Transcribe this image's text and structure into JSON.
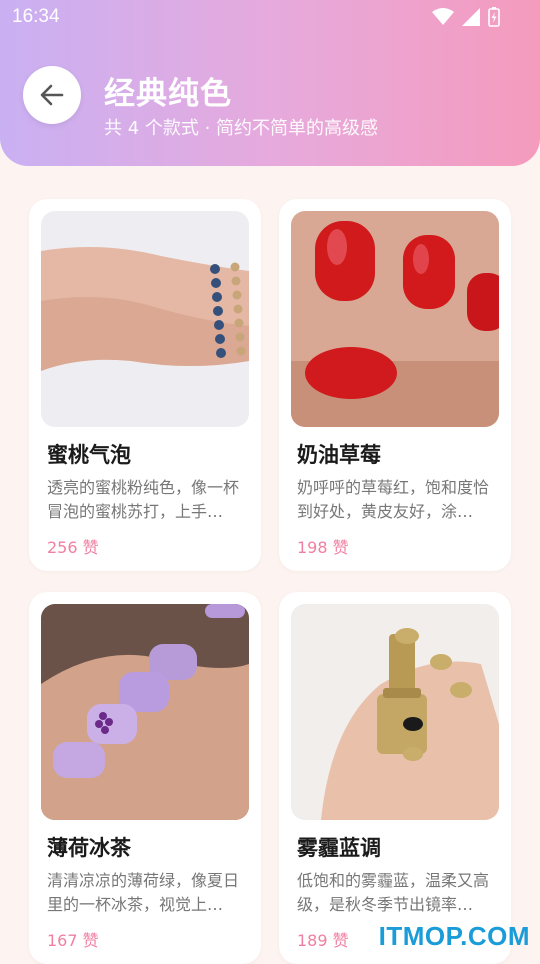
{
  "status_bar": {
    "time": "16:34"
  },
  "header": {
    "title": "经典纯色",
    "subtitle": "共 4 个款式 · 简约不简单的高级感"
  },
  "cards": [
    {
      "name": "蜜桃气泡",
      "desc": "透亮的蜜桃粉纯色，像一杯冒泡的蜜桃苏打，上手…",
      "likes": "256 赞"
    },
    {
      "name": "奶油草莓",
      "desc": "奶呼呼的草莓红，饱和度恰到好处，黄皮友好，涂…",
      "likes": "198 赞"
    },
    {
      "name": "薄荷冰茶",
      "desc": "清清凉凉的薄荷绿，像夏日里的一杯冰茶，视觉上…",
      "likes": "167 赞"
    },
    {
      "name": "雾霾蓝调",
      "desc": "低饱和的雾霾蓝，温柔又高级，是秋冬季节出镜率…",
      "likes": "189 赞"
    }
  ],
  "watermark": "ITMOP.COM",
  "colors": {
    "accent": "#f07fa2",
    "header_start": "#c9b0f3",
    "header_end": "#f59bbd",
    "background": "#fdf3f0"
  }
}
